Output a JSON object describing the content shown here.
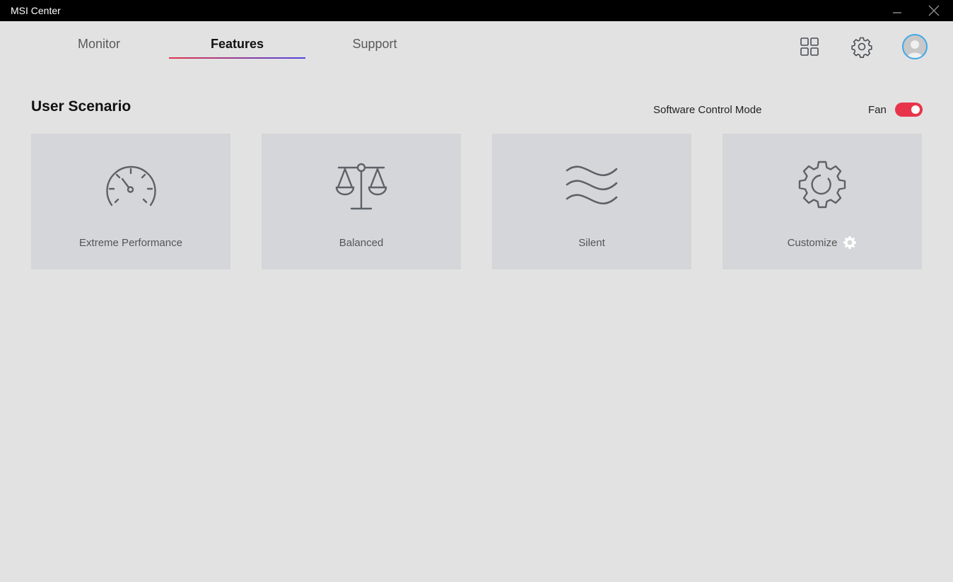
{
  "window": {
    "title": "MSI Center"
  },
  "tabs": [
    {
      "label": "Monitor"
    },
    {
      "label": "Features"
    },
    {
      "label": "Support"
    }
  ],
  "section": {
    "title": "User Scenario"
  },
  "mode": {
    "label": "Software Control Mode",
    "fan_label": "Fan",
    "fan_enabled": true,
    "toggle_color": "#e8344a"
  },
  "scenarios": [
    {
      "label": "Extreme Performance",
      "icon": "speedometer-icon"
    },
    {
      "label": "Balanced",
      "icon": "balance-scale-icon"
    },
    {
      "label": "Silent",
      "icon": "waves-icon"
    },
    {
      "label": "Customize",
      "icon": "gear-icon"
    }
  ],
  "colors": {
    "accent_red": "#e0334a",
    "accent_blue": "#4f46e0",
    "icon_gray": "#5d6168",
    "avatar_ring": "#3fa8e6"
  }
}
